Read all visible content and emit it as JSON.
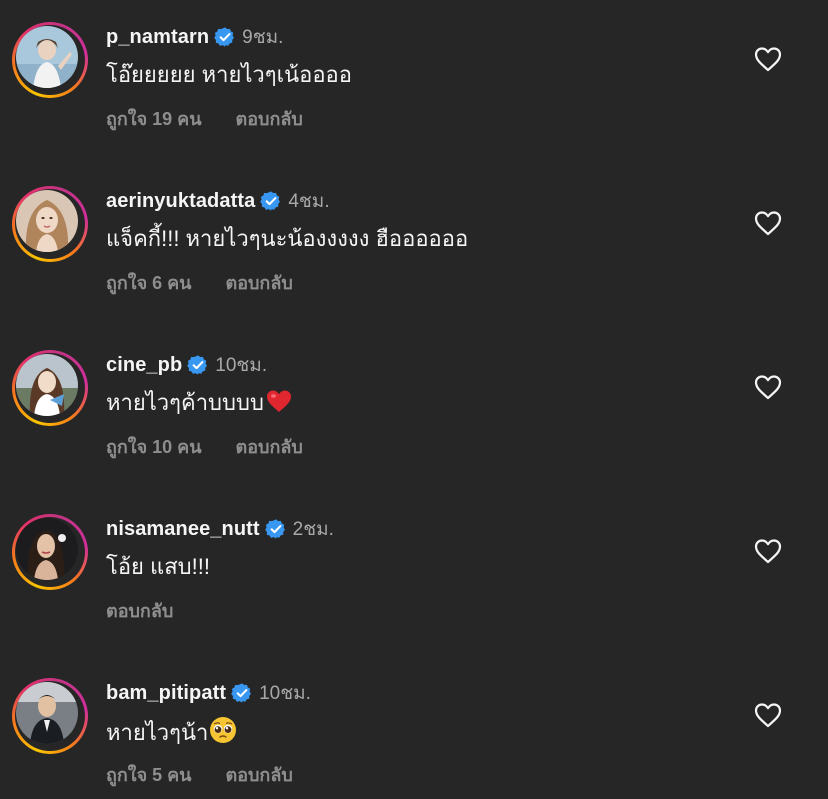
{
  "comments": [
    {
      "username": "p_namtarn",
      "time": "9ชม.",
      "text": "โอ๊ยยยยย หายไวๆเน้ออออ",
      "likes": "ถูกใจ 19 คน",
      "reply": "ตอบกลับ",
      "emoji": ""
    },
    {
      "username": "aerinyuktadatta",
      "time": "4ชม.",
      "text": "แจ็คกี้!!! หายไวๆนะน้องงงงง ฮืออออออ",
      "likes": "ถูกใจ 6 คน",
      "reply": "ตอบกลับ",
      "emoji": ""
    },
    {
      "username": "cine_pb",
      "time": "10ชม.",
      "text": "หายไวๆค้าบบบบ",
      "likes": "ถูกใจ 10 คน",
      "reply": "ตอบกลับ",
      "emoji": "red-heart"
    },
    {
      "username": "nisamanee_nutt",
      "time": "2ชม.",
      "text": "โอ้ย แสบ!!!",
      "likes": "",
      "reply": "ตอบกลับ",
      "emoji": ""
    },
    {
      "username": "bam_pitipatt",
      "time": "10ชม.",
      "text": "หายไวๆน้า",
      "likes": "ถูกใจ 5 คน",
      "reply": "ตอบกลับ",
      "emoji": "pleading-face"
    }
  ],
  "icons": {
    "verified": "verified-badge-icon",
    "like": "heart-outline-icon"
  },
  "colors": {
    "background": "#262626",
    "verified": "#3897f0",
    "secondary_text": "#8e8e8e"
  }
}
